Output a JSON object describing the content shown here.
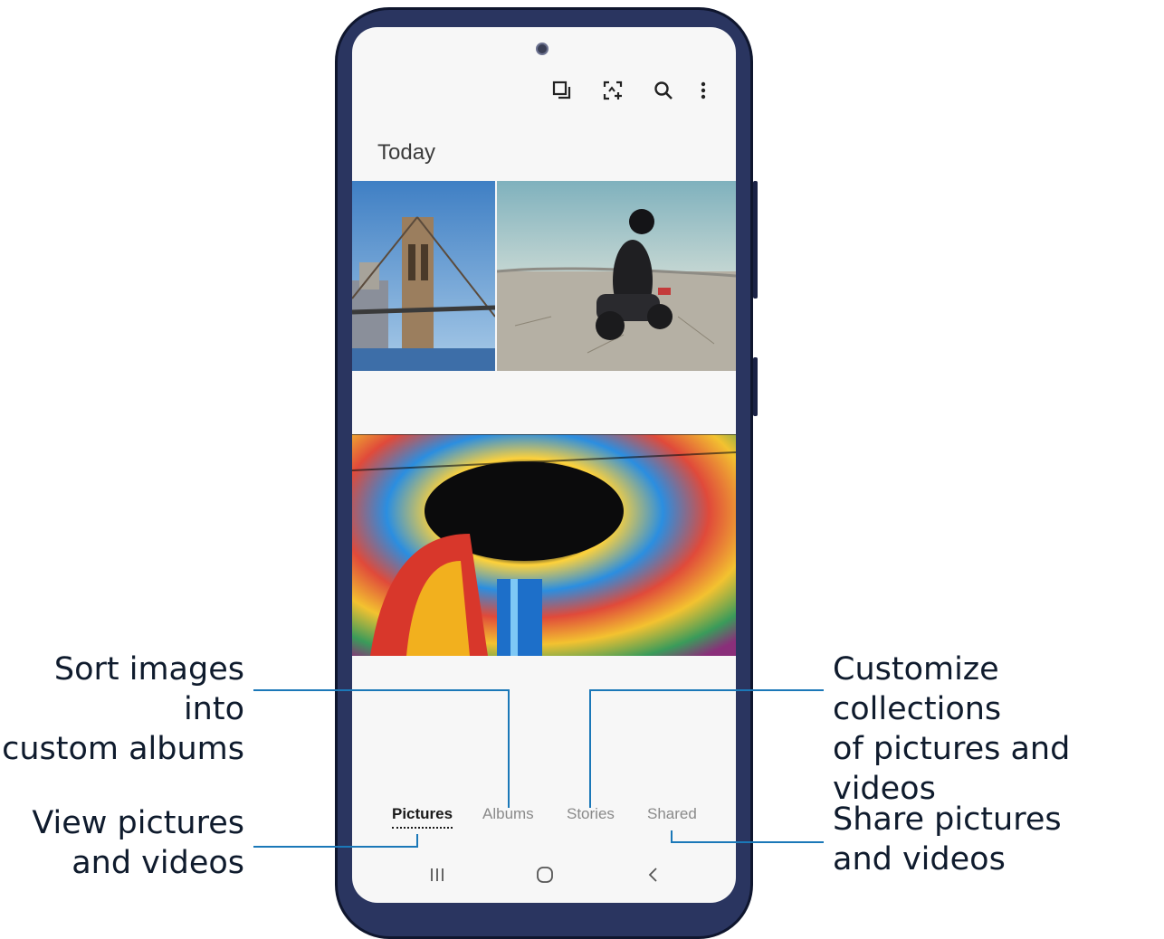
{
  "header": {
    "toolbar": [
      {
        "name": "select-icon"
      },
      {
        "name": "create-icon"
      },
      {
        "name": "search-icon"
      },
      {
        "name": "more-options-icon"
      }
    ]
  },
  "gallery": {
    "section_title": "Today",
    "photos": [
      "bridge photo",
      "motorcycle rider photo",
      "stained glass dome photo"
    ]
  },
  "tabs": [
    {
      "label": "Pictures",
      "active": true
    },
    {
      "label": "Albums",
      "active": false
    },
    {
      "label": "Stories",
      "active": false
    },
    {
      "label": "Shared",
      "active": false
    }
  ],
  "nav": [
    "recent-apps-icon",
    "home-icon",
    "back-icon"
  ],
  "callouts": {
    "albums": "Sort images into\ncustom albums",
    "pictures": "View pictures\nand videos",
    "stories": "Customize collections\nof pictures and videos",
    "shared": "Share pictures\nand videos"
  },
  "colors": {
    "callout_line": "#1b78b8",
    "phone_frame": "#2a3560",
    "screen_bg": "#f7f7f7"
  }
}
